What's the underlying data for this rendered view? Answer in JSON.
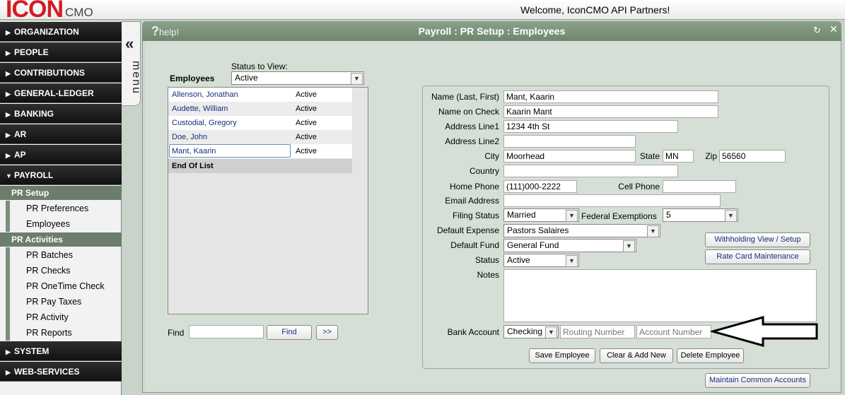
{
  "header": {
    "logo_main": "ICON",
    "logo_sub": "CMO",
    "welcome": "Welcome, IconCMO API Partners!"
  },
  "sidebar": {
    "nav_top": [
      "ORGANIZATION",
      "PEOPLE",
      "CONTRIBUTIONS",
      "GENERAL-LEDGER",
      "BANKING",
      "AR",
      "AP"
    ],
    "payroll": "PAYROLL",
    "pr_setup": "PR Setup",
    "pr_setup_items": [
      "PR Preferences",
      "Employees"
    ],
    "pr_activities": "PR Activities",
    "pr_activities_items": [
      "PR Batches",
      "PR Checks",
      "PR OneTime Check",
      "PR Pay Taxes",
      "PR Activity",
      "PR Reports"
    ],
    "nav_bottom": [
      "SYSTEM",
      "WEB-SERVICES"
    ],
    "menu_chevron": "«",
    "menu_label": "menu"
  },
  "panel": {
    "title": "Payroll : PR Setup : Employees",
    "help": "help!",
    "help_q": "?"
  },
  "employees": {
    "heading": "Employees",
    "status_label": "Status to View:",
    "status_value": "Active",
    "rows": [
      {
        "name": "Allenson, Jonathan",
        "status": "Active"
      },
      {
        "name": "Audette, William",
        "status": "Active"
      },
      {
        "name": "Custodial, Gregory",
        "status": "Active"
      },
      {
        "name": "Doe, John",
        "status": "Active"
      },
      {
        "name": "Mant, Kaarin",
        "status": "Active"
      }
    ],
    "end_of_list": "End Of List",
    "find_label": "Find",
    "find_value": "",
    "find_button": "Find",
    "next_button": ">>"
  },
  "form": {
    "labels": {
      "name": "Name (Last, First)",
      "name_on_check": "Name on Check",
      "address1": "Address Line1",
      "address2": "Address Line2",
      "city": "City",
      "state": "State",
      "zip": "Zip",
      "country": "Country",
      "home_phone": "Home Phone",
      "cell_phone": "Cell Phone",
      "email": "Email Address",
      "filing_status": "Filing Status",
      "federal_exemptions": "Federal Exemptions",
      "default_expense": "Default Expense",
      "default_fund": "Default Fund",
      "status": "Status",
      "notes": "Notes",
      "bank_account": "Bank Account"
    },
    "values": {
      "name": "Mant, Kaarin",
      "name_on_check": "Kaarin Mant",
      "address1": "1234 4th St",
      "address2": "",
      "city": "Moorhead",
      "state": "MN",
      "zip": "56560",
      "country": "",
      "home_phone": "(111)000-2222",
      "cell_phone": "",
      "email": "",
      "filing_status": "Married",
      "federal_exemptions": "5",
      "default_expense": "Pastors Salaires",
      "default_fund": "General Fund",
      "status": "Active",
      "notes": "",
      "bank_account_type": "Checking"
    },
    "placeholders": {
      "routing": "Routing Number",
      "account": "Account Number"
    },
    "buttons": {
      "withholding": "Withholding View / Setup",
      "rate_card": "Rate Card Maintenance",
      "save": "Save Employee",
      "clear_add": "Clear & Add New",
      "delete": "Delete Employee",
      "maintain_common": "Maintain Common Accounts"
    }
  }
}
